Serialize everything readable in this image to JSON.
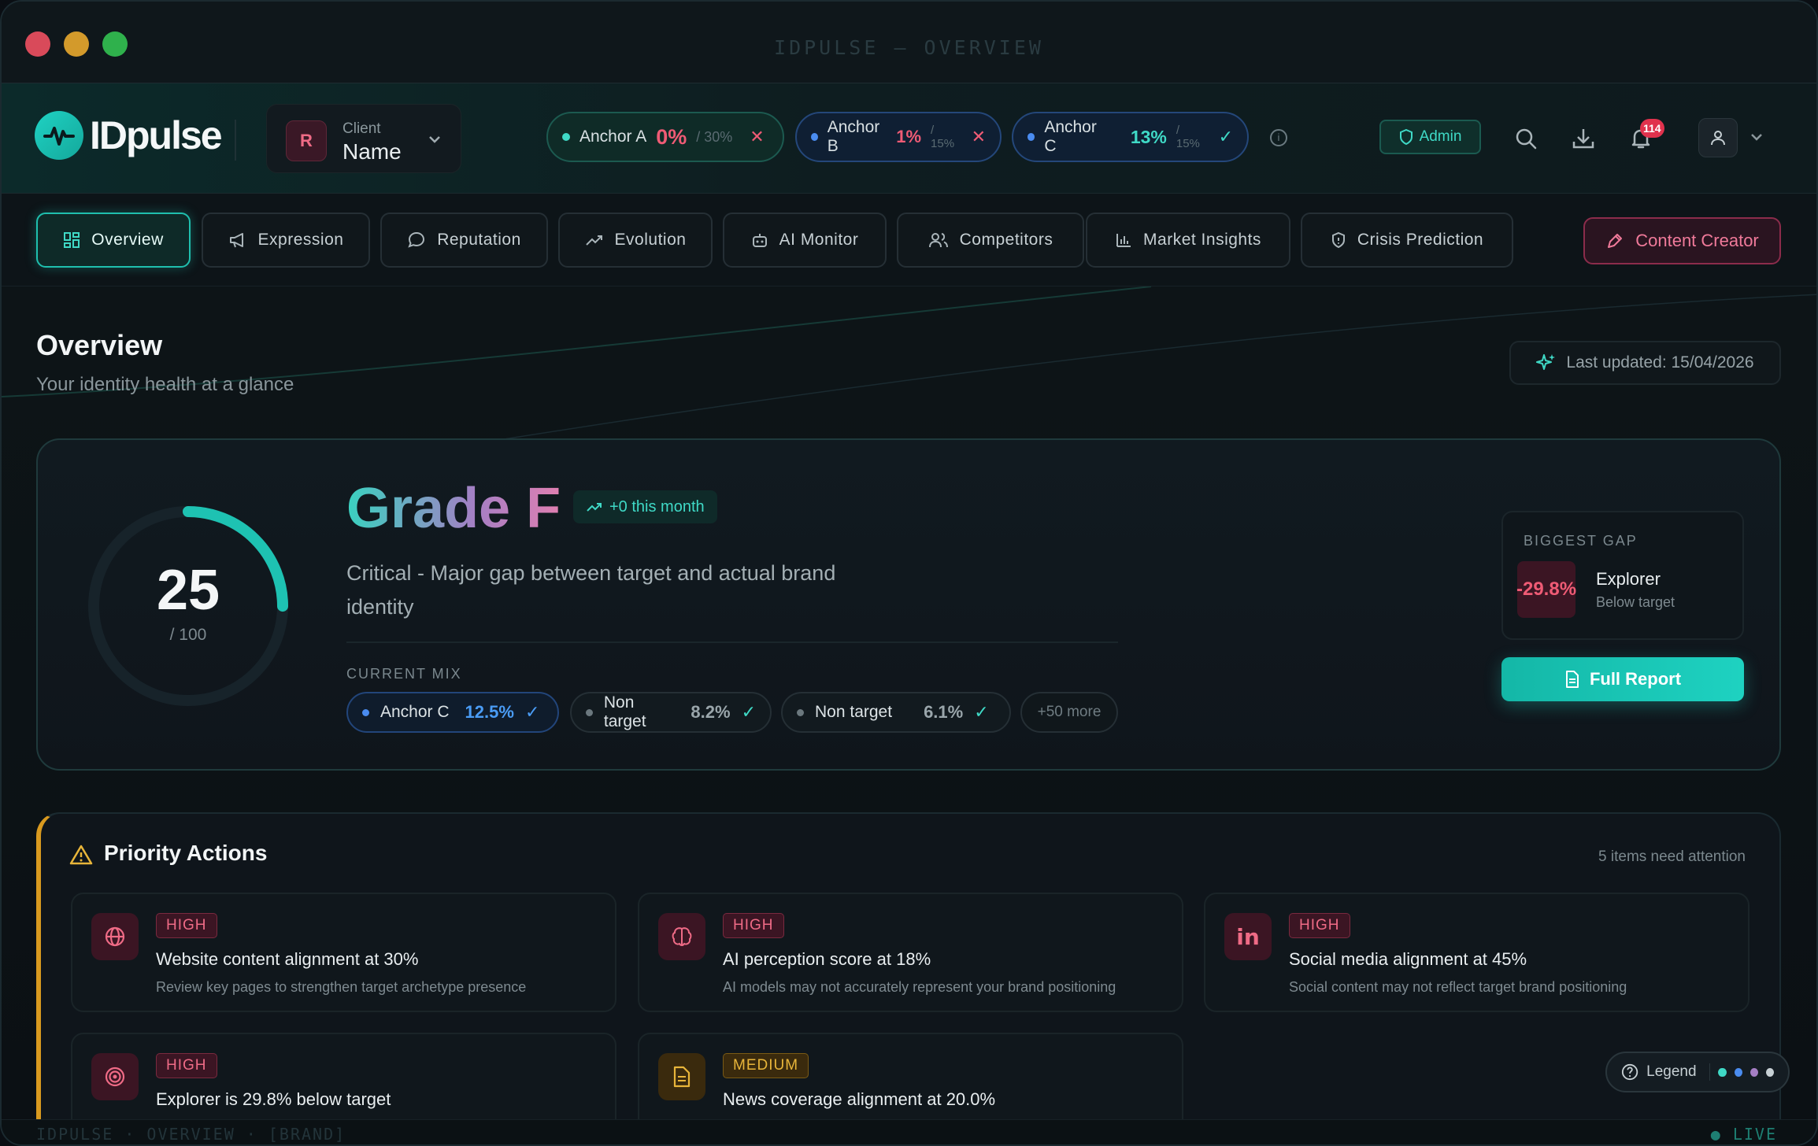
{
  "window": {
    "title": "IDPULSE — OVERVIEW"
  },
  "header": {
    "logo_text": "IDpulse",
    "client": {
      "avatar": "R",
      "label": "Client",
      "name": "Name"
    },
    "anchors": [
      {
        "name": "Anchor A",
        "value": "0%",
        "target": "/ 30%",
        "status": "✕",
        "color": "#3fd9c6",
        "value_color": "#ef5b75"
      },
      {
        "name": "Anchor B",
        "value": "1%",
        "target": "/ 15%",
        "status": "✕",
        "color": "#4a8cf0",
        "value_color": "#ef5b75"
      },
      {
        "name": "Anchor C",
        "value": "13%",
        "target": "/ 15%",
        "status": "✓",
        "color": "#4a8cf0",
        "value_color": "#3fd9c6"
      }
    ],
    "admin_label": "Admin",
    "notifications_count": "114"
  },
  "tabs": [
    {
      "label": "Overview",
      "icon": "grid-icon",
      "active": true
    },
    {
      "label": "Expression",
      "icon": "megaphone-icon"
    },
    {
      "label": "Reputation",
      "icon": "chat-icon"
    },
    {
      "label": "Evolution",
      "icon": "trend-icon"
    },
    {
      "label": "AI Monitor",
      "icon": "robot-icon"
    },
    {
      "label": "Competitors",
      "icon": "users-icon"
    },
    {
      "label": "Market Insights",
      "icon": "bar-chart-icon"
    },
    {
      "label": "Crisis Prediction",
      "icon": "shield-icon"
    }
  ],
  "content_creator_label": "Content Creator",
  "overview": {
    "title": "Overview",
    "subtitle": "Your identity health at a glance",
    "last_updated": "Last updated: 15/04/2026"
  },
  "grade_card": {
    "score": "25",
    "score_of": "/ 100",
    "score_fraction": 0.25,
    "grade": "Grade F",
    "month_change": "+0 this month",
    "description": "Critical - Major gap between target and actual brand identity",
    "current_mix_label": "CURRENT MIX",
    "mix": [
      {
        "name": "Anchor C",
        "value": "12.5%",
        "check": "✓"
      },
      {
        "name": "Non target",
        "value": "8.2%",
        "check": "✓"
      },
      {
        "name": "Non target",
        "value": "6.1%",
        "check": "✓"
      }
    ],
    "more": "+50 more",
    "biggest_gap": {
      "label": "BIGGEST GAP",
      "value": "-29.8%",
      "name": "Explorer",
      "sub": "Below target"
    },
    "report_button": "Full Report"
  },
  "priority": {
    "title": "Priority Actions",
    "count": "5 items need attention",
    "items": [
      {
        "tag": "HIGH",
        "title": "Website content alignment at 30%",
        "desc": "Review key pages to strengthen target archetype presence",
        "icon": "globe-icon"
      },
      {
        "tag": "HIGH",
        "title": "AI perception score at 18%",
        "desc": "AI models may not accurately represent your brand positioning",
        "icon": "brain-icon"
      },
      {
        "tag": "HIGH",
        "title": "Social media alignment at 45%",
        "desc": "Social content may not reflect target brand positioning",
        "icon": "linkedin-icon"
      },
      {
        "tag": "HIGH",
        "title": "Explorer is 29.8% below target",
        "desc": "",
        "icon": "target-icon"
      },
      {
        "tag": "MEDIUM",
        "title": "News coverage alignment at 20.0%",
        "desc": "",
        "icon": "document-icon"
      }
    ]
  },
  "legend_label": "Legend",
  "status_bar": {
    "left": "IDPULSE · OVERVIEW · [BRAND]",
    "right": "● LIVE"
  }
}
